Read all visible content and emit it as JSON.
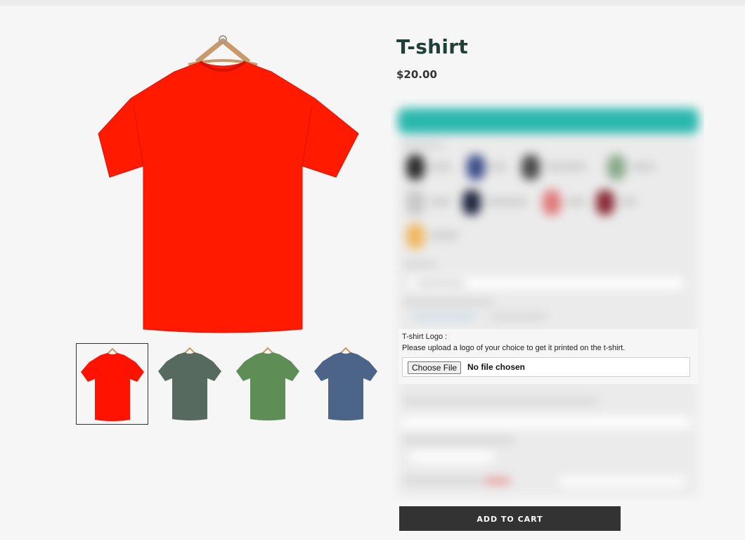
{
  "product": {
    "title": "T-shirt",
    "price": "$20.00",
    "main_image": {
      "subject": "red t-shirt on wooden hanger",
      "color": "#ff1a00"
    },
    "thumbnails": [
      {
        "color": "#ff1200",
        "selected": true
      },
      {
        "color": "#566a60",
        "selected": false
      },
      {
        "color": "#5e8d56",
        "selected": false
      },
      {
        "color": "#4c6488",
        "selected": false
      }
    ]
  },
  "options_panel": {
    "blurred": true,
    "header_color": "#2bb8ae",
    "color_swatches": [
      "#2c2c2c",
      "#3d4f8a",
      "#4a4a4a",
      "#8aa98a",
      "#c8c8c8",
      "#1e2540",
      "#e07a7a",
      "#8a2a36",
      "#f0b860"
    ]
  },
  "upload": {
    "label": "T-shirt Logo :",
    "description": "Please upload a logo of your choice to get it printed on the t-shirt.",
    "button_label": "Choose File",
    "status": "No file chosen"
  },
  "cart": {
    "button_label": "ADD TO CART"
  }
}
